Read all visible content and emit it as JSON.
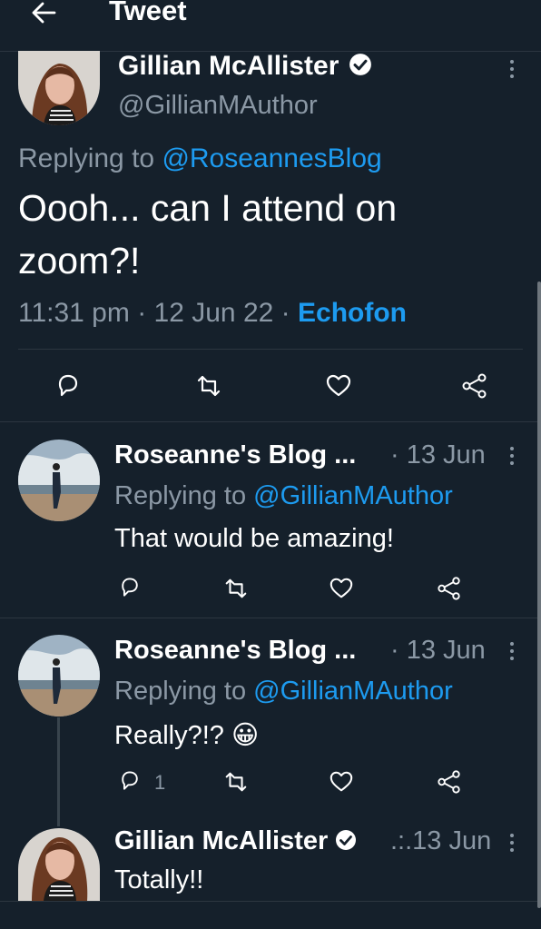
{
  "header": {
    "title": "Tweet"
  },
  "main_tweet": {
    "name": "Gillian McAllister",
    "handle": "@GillianMAuthor",
    "replying_prefix": "Replying to",
    "replying_to": "@RoseannesBlog",
    "text": "Oooh... can I attend on zoom?!",
    "time": "11:31 pm",
    "date": "12 Jun 22",
    "source": "Echofon",
    "separator": "·"
  },
  "replies": [
    {
      "name": "Roseanne's Blog ...",
      "time": "· 13 Jun",
      "replying_prefix": "Replying to",
      "replying_to": "@GillianMAuthor",
      "text": "That would be amazing!",
      "reply_count": ""
    },
    {
      "name": "Roseanne's Blog ...",
      "time": "· 13 Jun",
      "replying_prefix": "Replying to",
      "replying_to": "@GillianMAuthor",
      "text": "Really?!? 😀",
      "reply_count": "1"
    },
    {
      "name": "Gillian McAllister",
      "time": ".:.13 Jun",
      "text": "Totally!!"
    }
  ],
  "icons": {
    "back": "arrow-left-icon",
    "verified": "verified-badge-icon",
    "more": "more-vertical-icon",
    "reply": "reply-icon",
    "retweet": "retweet-icon",
    "like": "heart-icon",
    "share": "share-icon"
  },
  "colors": {
    "background": "#15202b",
    "text": "#ffffff",
    "muted": "#8b98a5",
    "accent": "#1d9bf0",
    "divider": "#2c3640"
  }
}
